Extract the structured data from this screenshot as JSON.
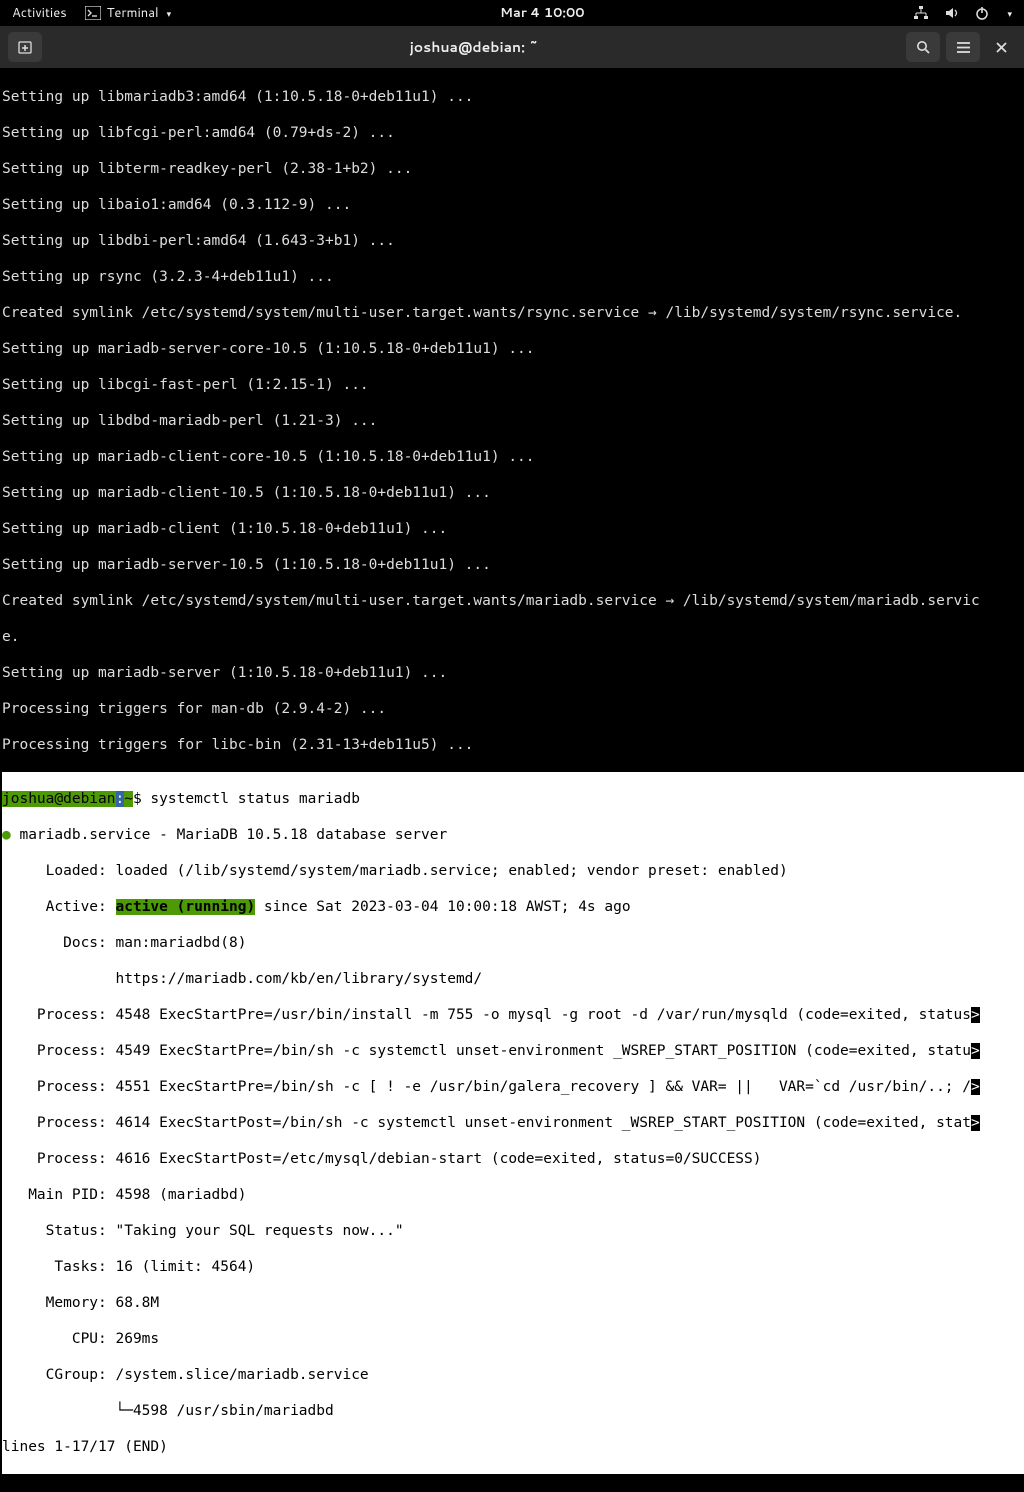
{
  "topbar": {
    "activities": "Activities",
    "app_name": "Terminal",
    "clock": "Mar 4  10:00"
  },
  "window": {
    "title": "joshua@debian: ~"
  },
  "setup_lines": [
    "Setting up libmariadb3:amd64 (1:10.5.18-0+deb11u1) ...",
    "Setting up libfcgi-perl:amd64 (0.79+ds-2) ...",
    "Setting up libterm-readkey-perl (2.38-1+b2) ...",
    "Setting up libaio1:amd64 (0.3.112-9) ...",
    "Setting up libdbi-perl:amd64 (1.643-3+b1) ...",
    "Setting up rsync (3.2.3-4+deb11u1) ...",
    "Created symlink /etc/systemd/system/multi-user.target.wants/rsync.service → /lib/systemd/system/rsync.service.",
    "Setting up mariadb-server-core-10.5 (1:10.5.18-0+deb11u1) ...",
    "Setting up libcgi-fast-perl (1:2.15-1) ...",
    "Setting up libdbd-mariadb-perl (1.21-3) ...",
    "Setting up mariadb-client-core-10.5 (1:10.5.18-0+deb11u1) ...",
    "Setting up mariadb-client-10.5 (1:10.5.18-0+deb11u1) ...",
    "Setting up mariadb-client (1:10.5.18-0+deb11u1) ...",
    "Setting up mariadb-server-10.5 (1:10.5.18-0+deb11u1) ...",
    "Created symlink /etc/systemd/system/multi-user.target.wants/mariadb.service → /lib/systemd/system/mariadb.servic",
    "e.",
    "Setting up mariadb-server (1:10.5.18-0+deb11u1) ...",
    "Processing triggers for man-db (2.9.4-2) ...",
    "Processing triggers for libc-bin (2.31-13+deb11u5) ..."
  ],
  "prompt": {
    "user_host": "joshua@debian",
    "colon": ":",
    "path": "~",
    "command": "$ systemctl status mariadb"
  },
  "status": {
    "title": " mariadb.service - MariaDB 10.5.18 database server",
    "loaded": "     Loaded: loaded (/lib/systemd/system/mariadb.service; enabled; vendor preset: enabled)",
    "active_pre": "     Active: ",
    "active_state": "active (running)",
    "active_post": " since Sat 2023-03-04 10:00:18 AWST; 4s ago",
    "docs1": "       Docs: man:mariadbd(8)",
    "docs2": "             https://mariadb.com/kb/en/library/systemd/",
    "proc1": "    Process: 4548 ExecStartPre=/usr/bin/install -m 755 -o mysql -g root -d /var/run/mysqld (code=exited, status",
    "proc2": "    Process: 4549 ExecStartPre=/bin/sh -c systemctl unset-environment _WSREP_START_POSITION (code=exited, statu",
    "proc3": "    Process: 4551 ExecStartPre=/bin/sh -c [ ! -e /usr/bin/galera_recovery ] && VAR= ||   VAR=`cd /usr/bin/..; /",
    "proc4": "    Process: 4614 ExecStartPost=/bin/sh -c systemctl unset-environment _WSREP_START_POSITION (code=exited, stat",
    "proc5": "    Process: 4616 ExecStartPost=/etc/mysql/debian-start (code=exited, status=0/SUCCESS)",
    "mainpid": "   Main PID: 4598 (mariadbd)",
    "status_line": "     Status: \"Taking your SQL requests now...\"",
    "tasks": "      Tasks: 16 (limit: 4564)",
    "memory": "     Memory: 68.8M",
    "cpu": "        CPU: 269ms",
    "cgroup": "     CGroup: /system.slice/mariadb.service",
    "cgroup_child": "             └─4598 /usr/sbin/mariadbd",
    "pager": "lines 1-17/17 (END)",
    "trunc": ">"
  }
}
